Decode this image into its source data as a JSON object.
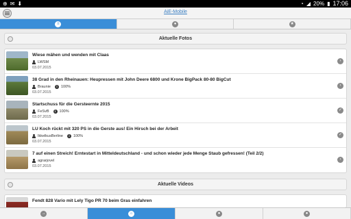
{
  "status_bar": {
    "battery_percent": "20%",
    "time": "17:06"
  },
  "app": {
    "title": "AiE-Mobile"
  },
  "top_tabs": [
    {
      "name": "list",
      "icon": "list-icon",
      "glyph": "≡",
      "active": true
    },
    {
      "name": "chat",
      "icon": "chat-icon",
      "glyph": "●",
      "active": false
    },
    {
      "name": "star",
      "icon": "star-icon",
      "glyph": "★",
      "active": false
    }
  ],
  "photos_section": {
    "title": "Aktuelle Fotos"
  },
  "photos": [
    {
      "title": "Wiese mähen und wenden mit Claas",
      "user": "LWSM",
      "rating": "",
      "date": "03.07.2015",
      "thumb_color": "#6f8a4a"
    },
    {
      "title": "38 Grad in den Rheinauen: Heupressen mit John Deere 6800 und Krone BigPack 80-80 BigCut",
      "user": "Braunie",
      "rating": "100%",
      "date": "03.07.2015",
      "thumb_color": "#5c7a3a"
    },
    {
      "title": "Startschuss für die Gersteernte 2015",
      "user": "FeSvB",
      "rating": "100%",
      "date": "03.07.2015",
      "thumb_color": "#8f8a6a"
    },
    {
      "title": "LU Koch rückt mit 320 PS in die Gerste aus! Ein Hirsch bei der Arbeit",
      "user": "IkkelkusBerline",
      "rating": "100%",
      "date": "03.07.2015",
      "thumb_color": "#a08a58"
    },
    {
      "title": "7 auf einen Streich! Erntestart in Mitteldeutschland - und schon wieder jede Menge Staub gefressen! (Teil 2/2)",
      "user": "agrarjovel",
      "rating": "",
      "date": "03.07.2015",
      "thumb_color": "#b59a6a"
    }
  ],
  "videos_section": {
    "title": "Aktuelle Videos"
  },
  "videos": [
    {
      "title": "Fendt 828 Vario mit Lely Tigo PR 70 beim Gras einfahren",
      "thumb_color": "#8a2a22"
    }
  ],
  "bottom_tabs": [
    {
      "name": "login",
      "icon": "login-icon",
      "glyph": "→",
      "active": false
    },
    {
      "name": "home",
      "icon": "home-icon",
      "glyph": "⌂",
      "active": true
    },
    {
      "name": "messages",
      "icon": "chat-icon",
      "glyph": "●",
      "active": false
    },
    {
      "name": "profile",
      "icon": "user-icon",
      "glyph": "●",
      "active": false
    }
  ]
}
